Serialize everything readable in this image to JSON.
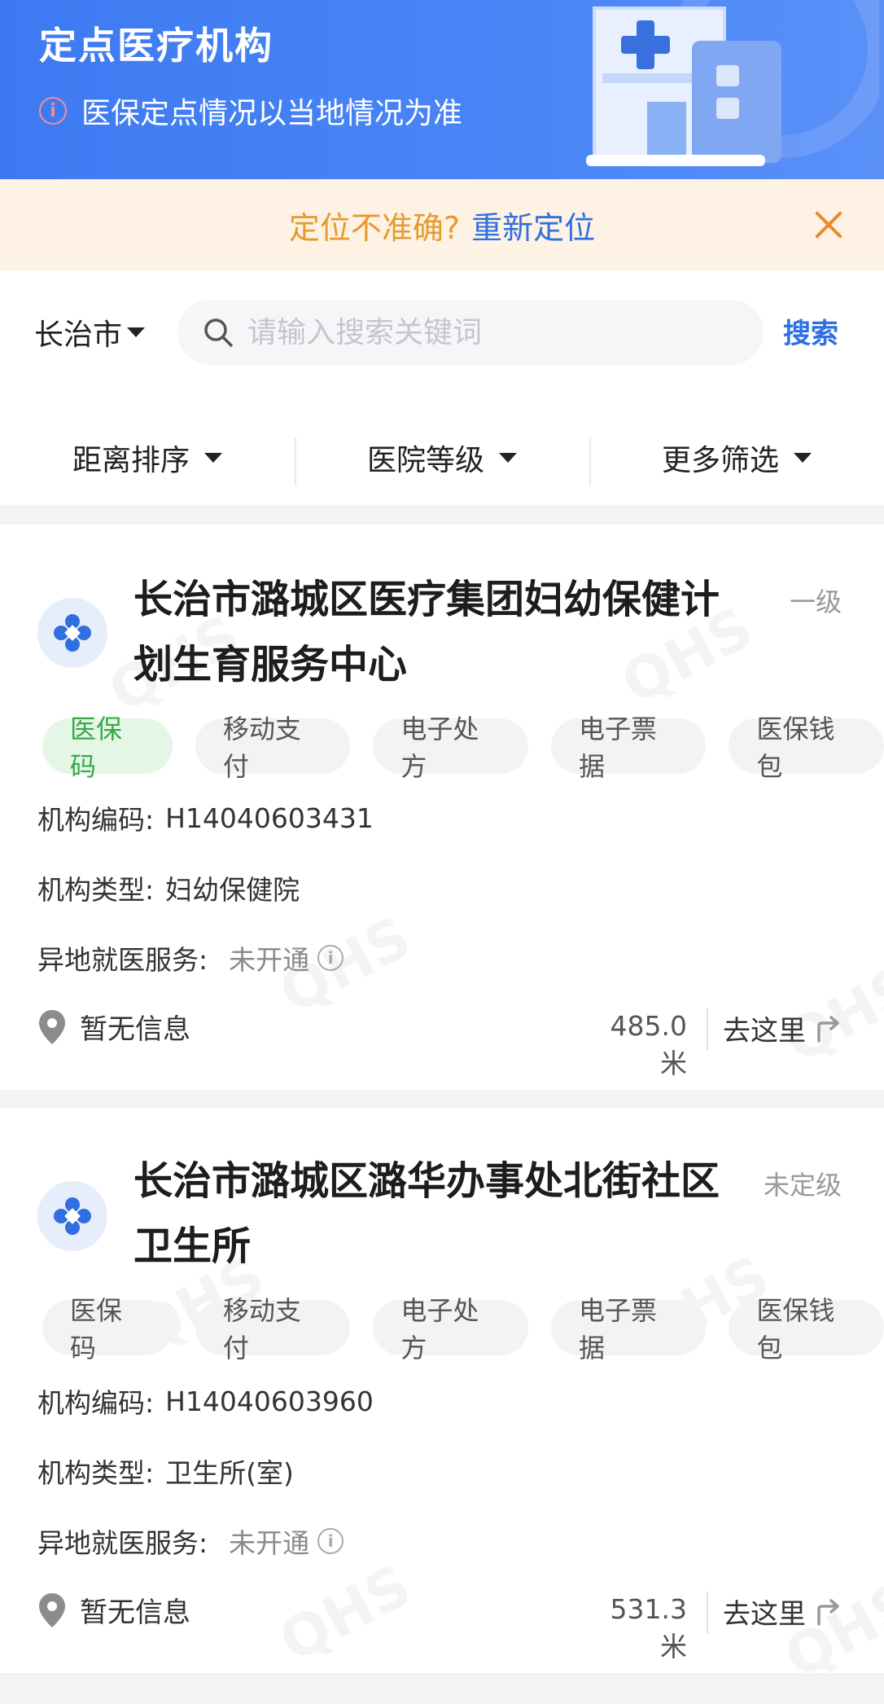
{
  "header": {
    "title": "定点医疗机构",
    "subtitle": "医保定点情况以当地情况为准"
  },
  "location_banner": {
    "text": "定位不准确?",
    "link": "重新定位"
  },
  "search": {
    "city": "长治市",
    "placeholder": "请输入搜索关键词",
    "button": "搜索"
  },
  "filters": [
    "距离排序",
    "医院等级",
    "更多筛选"
  ],
  "institutions": [
    {
      "name": "长治市潞城区医疗集团妇幼保健计划生育服务中心",
      "level": "一级",
      "tags": [
        {
          "label": "医保码",
          "active": true
        },
        {
          "label": "移动支付",
          "active": false
        },
        {
          "label": "电子处方",
          "active": false
        },
        {
          "label": "电子票据",
          "active": false
        },
        {
          "label": "医保钱包",
          "active": false
        }
      ],
      "code_label": "机构编码:",
      "code": "H14040603431",
      "type_label": "机构类型:",
      "type": "妇幼保健院",
      "remote_label": "异地就医服务:",
      "remote": "未开通",
      "address": "暂无信息",
      "distance": "485.0米",
      "goto": "去这里"
    },
    {
      "name": "长治市潞城区潞华办事处北街社区卫生所",
      "level": "未定级",
      "tags": [
        {
          "label": "医保码",
          "active": false
        },
        {
          "label": "移动支付",
          "active": false
        },
        {
          "label": "电子处方",
          "active": false
        },
        {
          "label": "电子票据",
          "active": false
        },
        {
          "label": "医保钱包",
          "active": false
        }
      ],
      "code_label": "机构编码:",
      "code": "H14040603960",
      "type_label": "机构类型:",
      "type": "卫生所(室)",
      "remote_label": "异地就医服务:",
      "remote": "未开通",
      "address": "暂无信息",
      "distance": "531.3米",
      "goto": "去这里"
    }
  ],
  "colors": {
    "header_blue": "#3d7af2",
    "banner_bg": "#fdf2e4",
    "banner_orange": "#e89a2c",
    "link_blue": "#2f6fe0",
    "tag_active_green": "#35a94a"
  }
}
